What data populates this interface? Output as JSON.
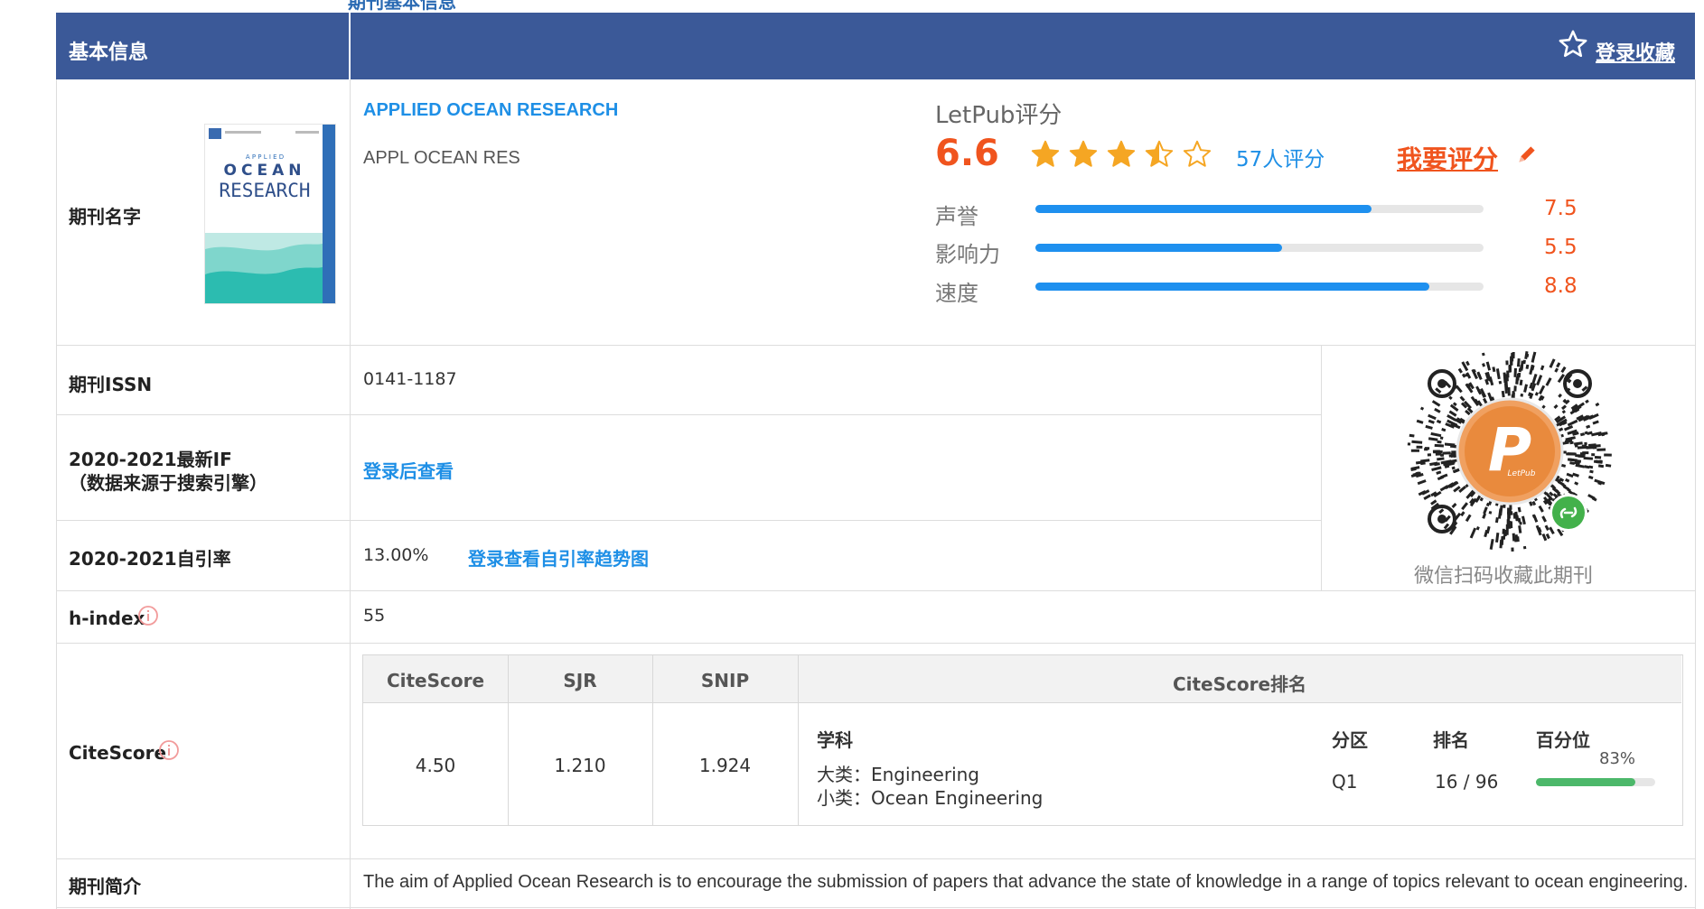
{
  "top_partial_caption": "期刊基本信息",
  "header": {
    "title": "基本信息",
    "favorite_label": "登录收藏"
  },
  "journal": {
    "name_label": "期刊名字",
    "full_name": "APPLIED OCEAN RESEARCH",
    "abbreviation": "APPL OCEAN RES",
    "cover": {
      "line1": "A P P L I E D",
      "line2": "OCEAN",
      "line3": "RESEARCH"
    }
  },
  "rating": {
    "title": "LetPub评分",
    "score": "6.6",
    "stars": 3.5,
    "count": "57人评分",
    "rate_link": "我要评分",
    "bars": [
      {
        "label": "声誉",
        "value": "7.5",
        "fraction": 0.75
      },
      {
        "label": "影响力",
        "value": "5.5",
        "fraction": 0.55
      },
      {
        "label": "速度",
        "value": "8.8",
        "fraction": 0.88
      }
    ]
  },
  "issn": {
    "label": "期刊ISSN",
    "value": "0141-1187"
  },
  "impact_factor": {
    "label_line1": "2020-2021最新IF",
    "label_line2": "（数据来源于搜索引擎）",
    "link": "登录后查看"
  },
  "self_citation": {
    "label": "2020-2021自引率",
    "value": "13.00%",
    "link": "登录查看自引率趋势图"
  },
  "h_index": {
    "label": "h-index",
    "value": "55"
  },
  "qr": {
    "caption": "微信扫码收藏此期刊",
    "center_text": "LetPub"
  },
  "citescore": {
    "label": "CiteScore",
    "headers": [
      "CiteScore",
      "SJR",
      "SNIP",
      "CiteScore排名"
    ],
    "values": [
      "4.50",
      "1.210",
      "1.924"
    ],
    "ranking": {
      "col_subject": "学科",
      "col_zone": "分区",
      "col_rank": "排名",
      "col_percentile": "百分位",
      "major": "大类：Engineering",
      "minor": "小类：Ocean Engineering",
      "zone": "Q1",
      "rank": "16 / 96",
      "percentile": "83%",
      "percentile_fraction": 0.83
    }
  },
  "intro": {
    "label": "期刊简介",
    "text": "The aim of Applied Ocean Research is to encourage the submission of papers that advance the state of knowledge in a range of topics relevant to ocean engineering."
  },
  "colors": {
    "header_bg": "#3b5998",
    "accent_orange": "#f0541e",
    "link_blue": "#1e8fe6",
    "star": "#f5a623",
    "bar_blue": "#1e90ef",
    "bar_green": "#4cb86a"
  },
  "icons": [
    "star-outline-icon",
    "pencil-icon",
    "info-icon",
    "qr-code",
    "wechat-mini-icon"
  ]
}
